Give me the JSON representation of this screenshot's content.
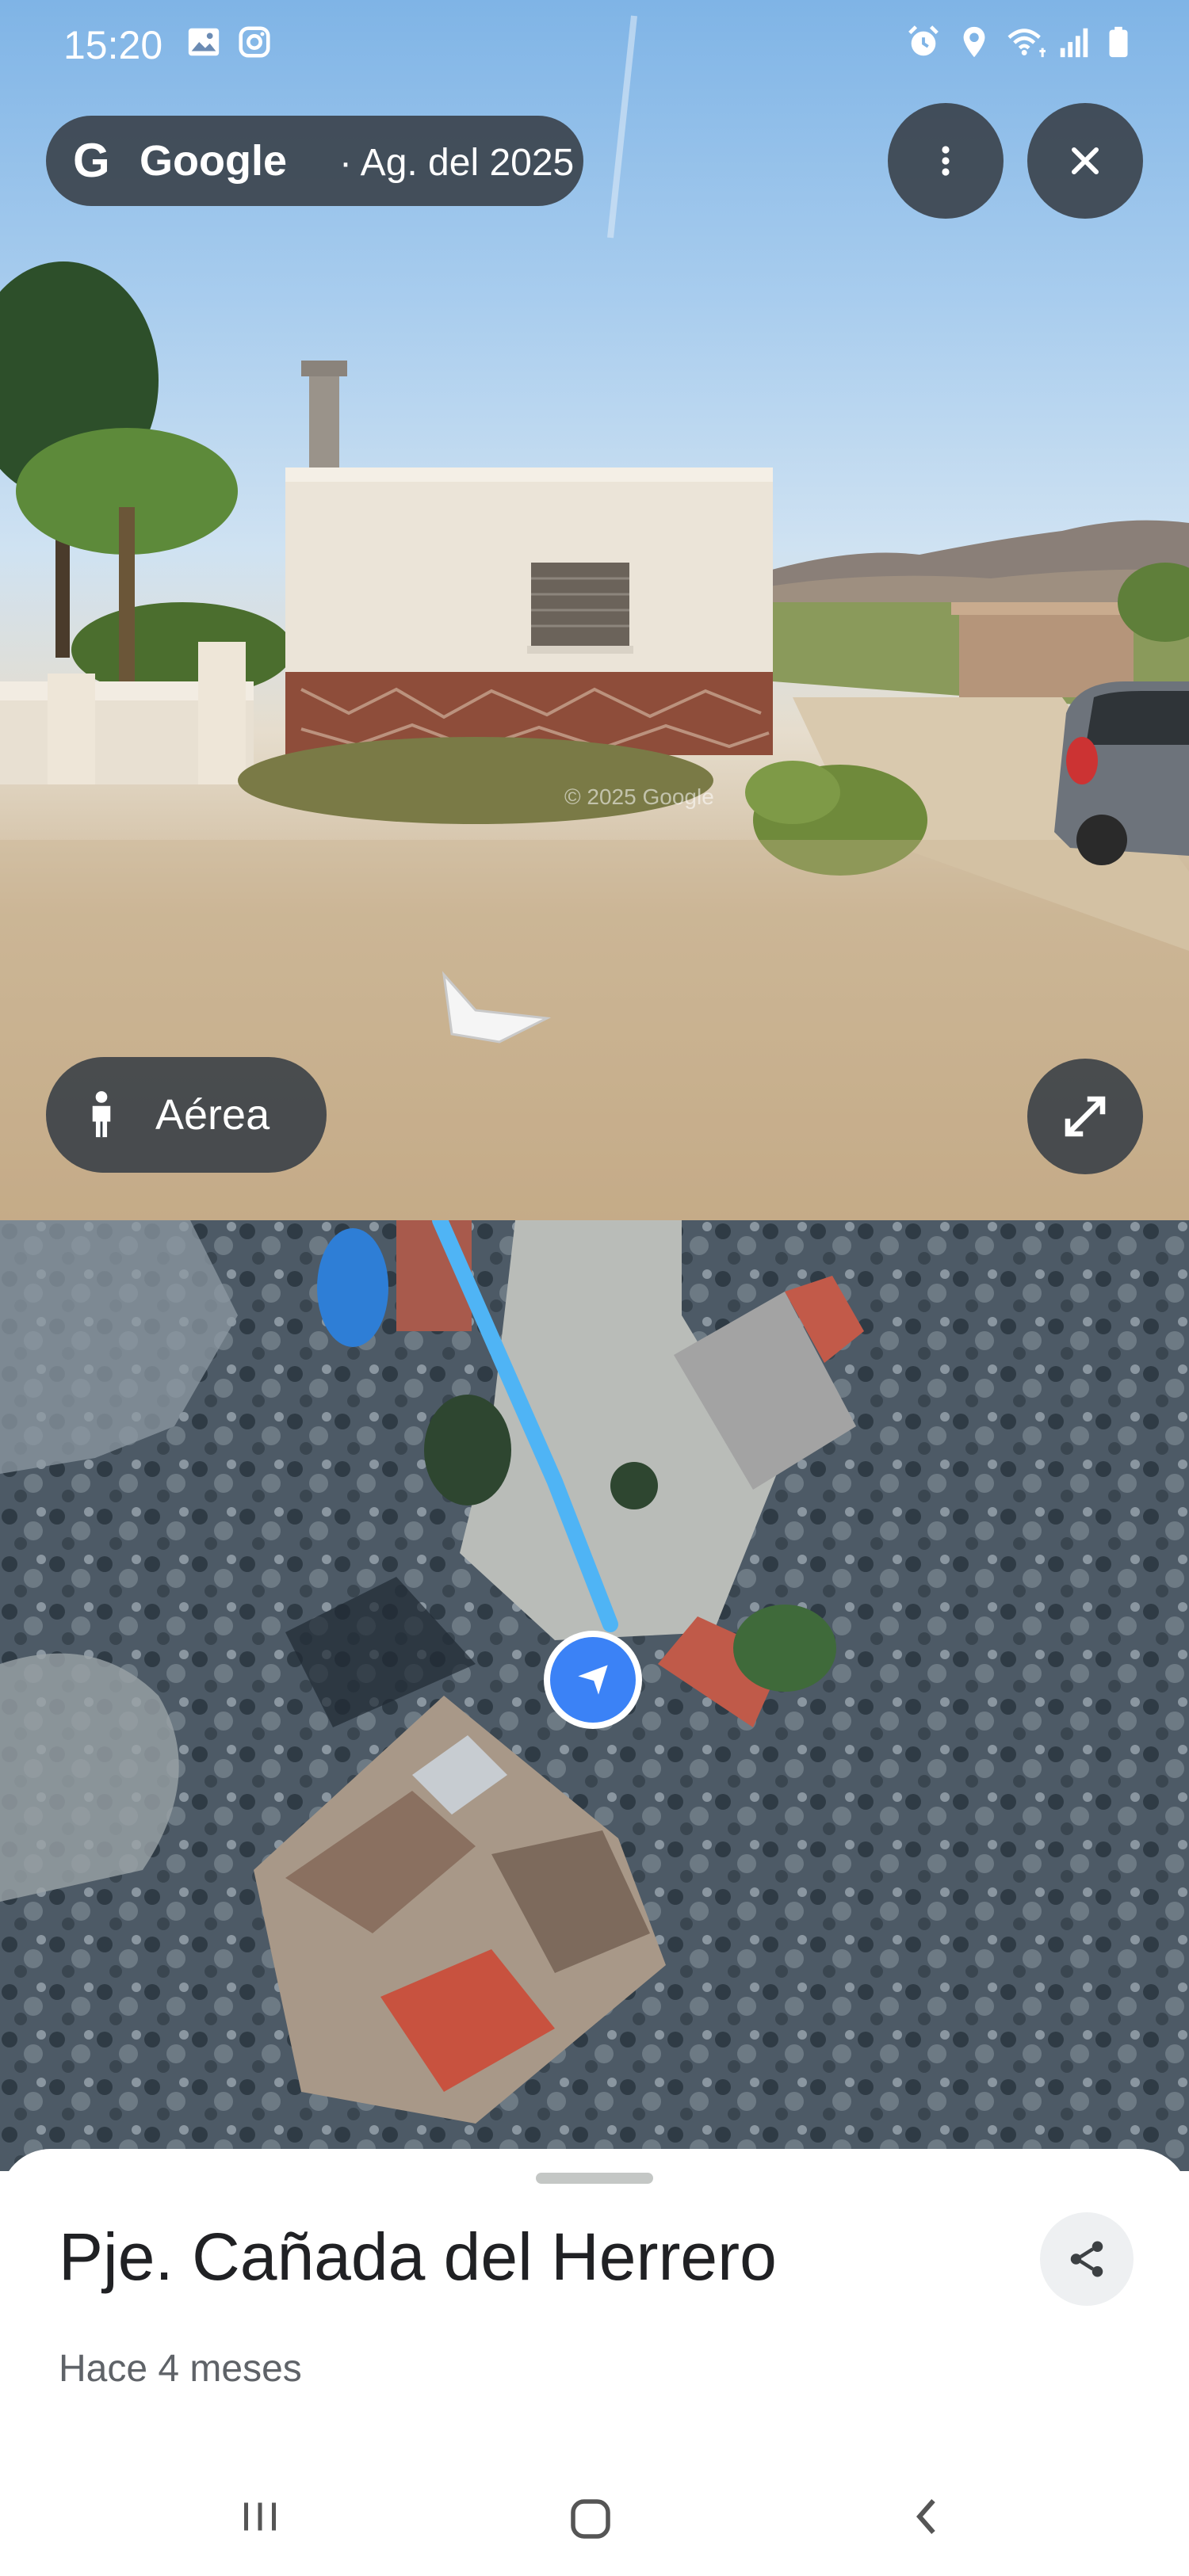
{
  "status_bar": {
    "time": "15:20",
    "left_icons": [
      "gallery-icon",
      "instagram-icon"
    ],
    "right_icons": [
      "alarm-icon",
      "location-icon",
      "wifi-icon",
      "signal-icon",
      "battery-icon"
    ]
  },
  "streetview": {
    "source_brand": "Google",
    "capture_date": "· Ag. del 2025",
    "watermark": "© 2025 Google",
    "view_toggle_label": "Aérea",
    "menu_icon": "more-vert-icon",
    "close_icon": "close-icon",
    "expand_icon": "expand-icon"
  },
  "bottom_sheet": {
    "place_name": "Pje. Cañada del Herrero",
    "relative_time": "Hace 4 meses",
    "share_icon": "share-icon"
  },
  "nav_bar": {
    "icons": [
      "recents-icon",
      "home-icon",
      "back-icon"
    ]
  },
  "colors": {
    "route": "#4fb4f5",
    "position_marker": "#3b82f6",
    "overlay_button": "#373e46"
  }
}
